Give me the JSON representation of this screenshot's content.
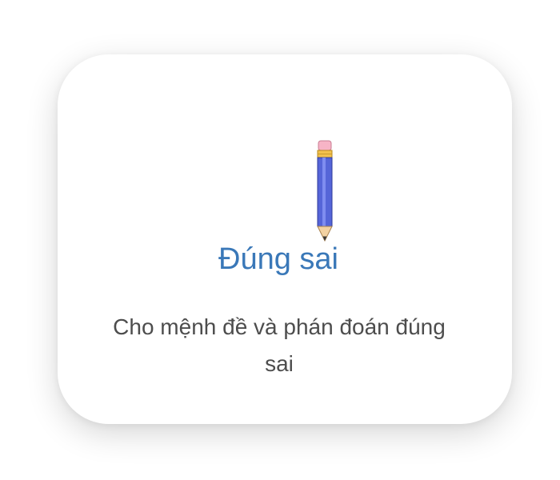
{
  "card": {
    "title": "Đúng sai",
    "description": "Cho mệnh đề và phán đoán đúng sai",
    "icon": "pencil-icon",
    "title_color": "#3a78b8",
    "text_color": "#4d4d4d"
  }
}
